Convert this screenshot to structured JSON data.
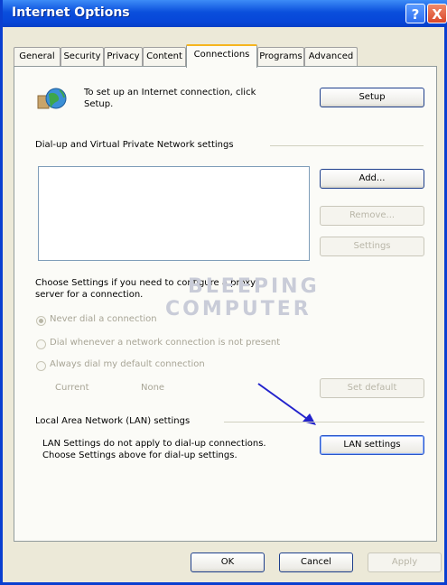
{
  "window": {
    "title": "Internet Options",
    "help_glyph": "?",
    "close_glyph": "X"
  },
  "tabs": [
    {
      "label": "General"
    },
    {
      "label": "Security"
    },
    {
      "label": "Privacy"
    },
    {
      "label": "Content"
    },
    {
      "label": "Connections",
      "active": true
    },
    {
      "label": "Programs"
    },
    {
      "label": "Advanced"
    }
  ],
  "setup": {
    "line1": "To set up an Internet connection, click",
    "line2": "Setup.",
    "button": "Setup"
  },
  "dialup": {
    "section_label": "Dial-up and Virtual Private Network settings",
    "add_button": "Add...",
    "remove_button": "Remove...",
    "settings_button": "Settings"
  },
  "proxy": {
    "line1": "Choose Settings if you need to configure a proxy",
    "line2": "server for a connection."
  },
  "options": {
    "never_dial": "Never dial a connection",
    "dial_when_no_network": "Dial whenever a network connection is not present",
    "always_dial": "Always dial my default connection",
    "selected": "never_dial"
  },
  "current": {
    "label": "Current",
    "value": "None",
    "set_default_button": "Set default"
  },
  "lan": {
    "section_label": "Local Area Network (LAN) settings",
    "line1": "LAN Settings do not apply to dial-up connections.",
    "line2": "Choose Settings above for dial-up settings.",
    "button": "LAN settings"
  },
  "watermark": {
    "line1": "BLEEPING",
    "line2": "COMPUTER"
  },
  "footer": {
    "ok": "OK",
    "cancel": "Cancel",
    "apply": "Apply"
  },
  "colors": {
    "titlebar": "#0a4fdc",
    "arrow": "#2222cc",
    "active_tab_accent": "#f5b51f"
  }
}
